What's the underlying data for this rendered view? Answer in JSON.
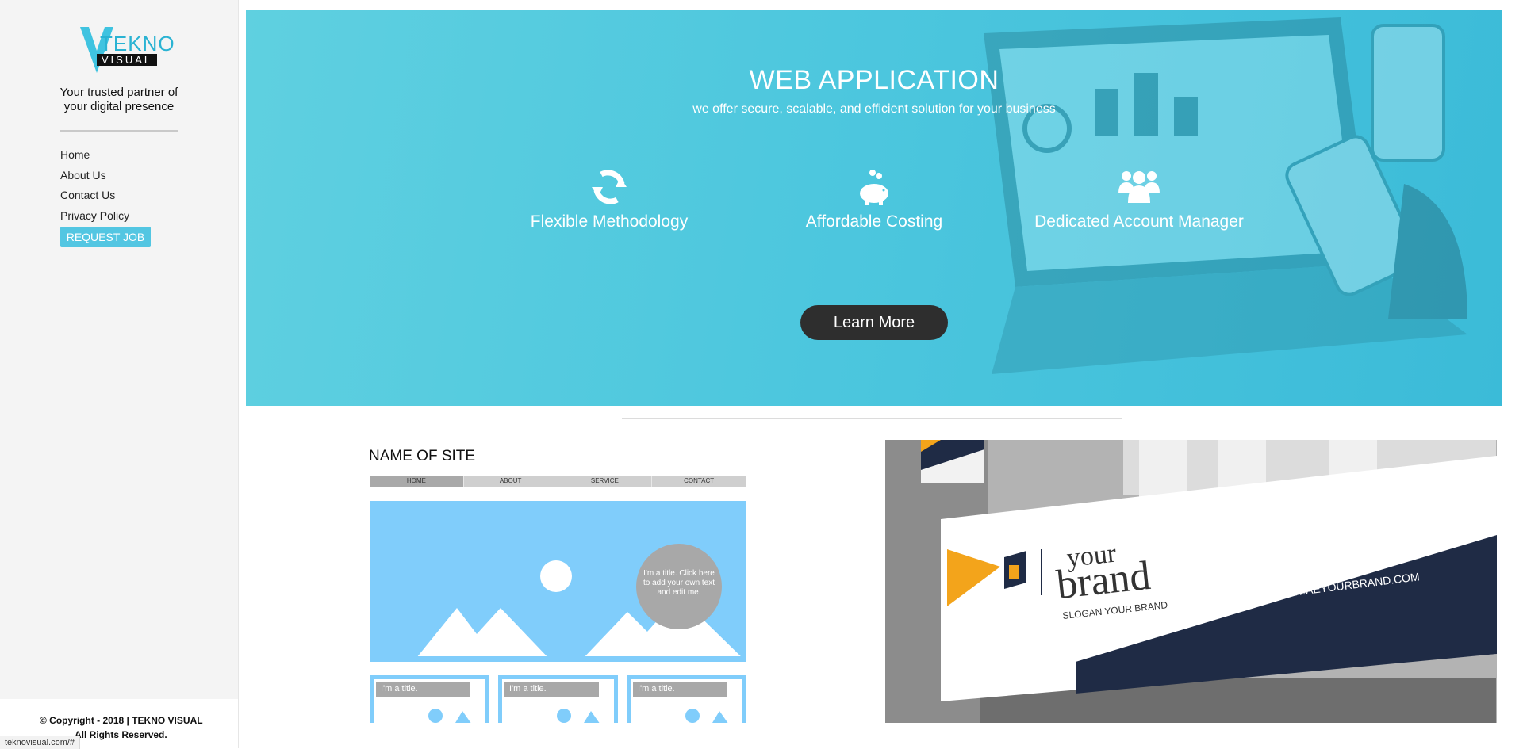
{
  "sidebar": {
    "logo": {
      "word1": "TEKNO",
      "word2": "VISUAL"
    },
    "tagline_line1": "Your trusted partner of",
    "tagline_line2": "your  digital  presence",
    "nav": [
      {
        "label": "Home"
      },
      {
        "label": "About Us"
      },
      {
        "label": "Contact Us"
      },
      {
        "label": "Privacy Policy"
      }
    ],
    "request_button": "REQUEST JOB",
    "copyright_line1": "© Copyright - 2018 | TEKNO VISUAL",
    "copyright_line2": "All Rights Reserved."
  },
  "status_bar": {
    "url": "teknovisual.com/#"
  },
  "hero": {
    "title": "WEB APPLICATION",
    "subtitle": "we offer secure, scalable, and efficient solution for your business",
    "features": [
      {
        "label": "Flexible Methodology",
        "icon": "sync-icon"
      },
      {
        "label": "Affordable Costing",
        "icon": "piggy-bank-icon"
      },
      {
        "label": "Dedicated Account Manager",
        "icon": "group-icon"
      }
    ],
    "button": "Learn More"
  },
  "mockup": {
    "site_name": "NAME OF SITE",
    "nav": [
      "HOME",
      "ABOUT",
      "SERVICE",
      "CONTACT"
    ],
    "bubble_text": "I'm a title. Click here to add your own text and edit me.",
    "card_titles": [
      "I'm a title.",
      "I'm a title.",
      "I'm a title."
    ]
  },
  "brand_sign": {
    "word_your": "your",
    "word_brand": "brand",
    "slogan": "SLOGAN YOUR BRAND",
    "url": "WWW.AEYOURBRAND.COM"
  },
  "colors": {
    "accent": "#53c6e2",
    "hero": "#4dc7de",
    "button_dark": "#2e2e2e",
    "mock_sky": "#80cdfb",
    "sign_navy": "#1f2b45",
    "sign_yellow": "#f3a41b"
  }
}
